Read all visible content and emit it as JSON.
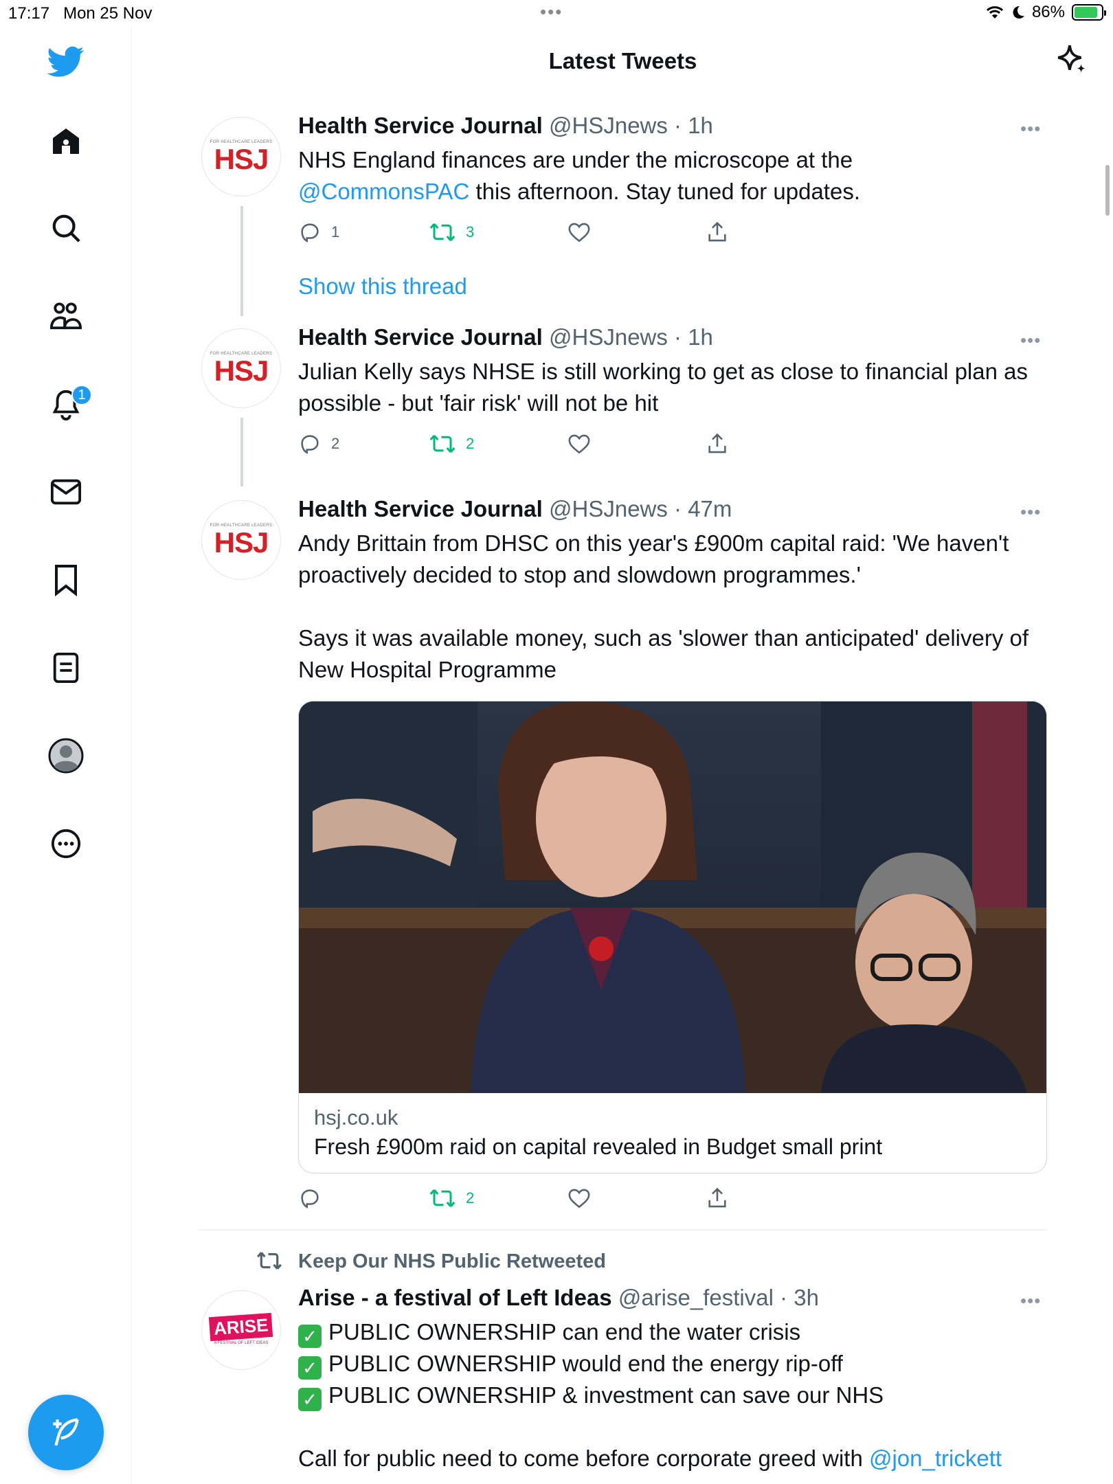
{
  "status_bar": {
    "time": "17:17",
    "date": "Mon 25 Nov",
    "battery_percent": "86%",
    "battery_level": 0.86
  },
  "header": {
    "title": "Latest Tweets"
  },
  "sidebar": {
    "notification_count": "1"
  },
  "colors": {
    "accent": "#1d9bf0",
    "retweet": "#00ba7c",
    "hsj_red": "#d71f26"
  },
  "tweets": [
    {
      "name": "Health Service Journal",
      "meta": "@HSJnews · 1h",
      "text_before": "NHS England finances are under the microscope at the",
      "mention": "@CommonsPAC",
      "text_after": " this afternoon. Stay tuned for updates.",
      "replies": "1",
      "retweets": "3",
      "show_thread": "Show this thread"
    },
    {
      "name": "Health Service Journal",
      "meta": "@HSJnews · 1h",
      "text": "Julian Kelly says NHSE is still working to get as close to financial plan as possible - but 'fair risk' will not be hit",
      "replies": "2",
      "retweets": "2"
    },
    {
      "name": "Health Service Journal",
      "meta": "@HSJnews · 47m",
      "text_p1": "Andy Brittain from DHSC on this year's £900m capital raid: 'We haven't proactively decided to stop and slowdown programmes.'",
      "text_p2": "Says it was available money, such as 'slower than anticipated' delivery of New Hospital Programme",
      "card_domain": "hsj.co.uk",
      "card_title": "Fresh £900m raid on capital revealed in Budget small print",
      "retweets": "2"
    }
  ],
  "avatar_logo": {
    "small": "FOR HEALTHCARE LEADERS",
    "logo": "HSJ"
  },
  "retweeted": {
    "label": "Keep Our NHS Public Retweeted",
    "name": "Arise - a festival of Left Ideas",
    "meta": "@arise_festival · 3h",
    "avatar_word": "ARISE",
    "avatar_sub": "A FESTIVAL OF LEFT IDEAS",
    "lines": [
      "PUBLIC OWNERSHIP can end the water crisis",
      "PUBLIC OWNERSHIP would end the energy rip-off",
      "PUBLIC OWNERSHIP & investment can save our NHS"
    ],
    "call_text": "Call for public need to come before corporate greed with ",
    "call_mention": "@jon_trickett"
  }
}
